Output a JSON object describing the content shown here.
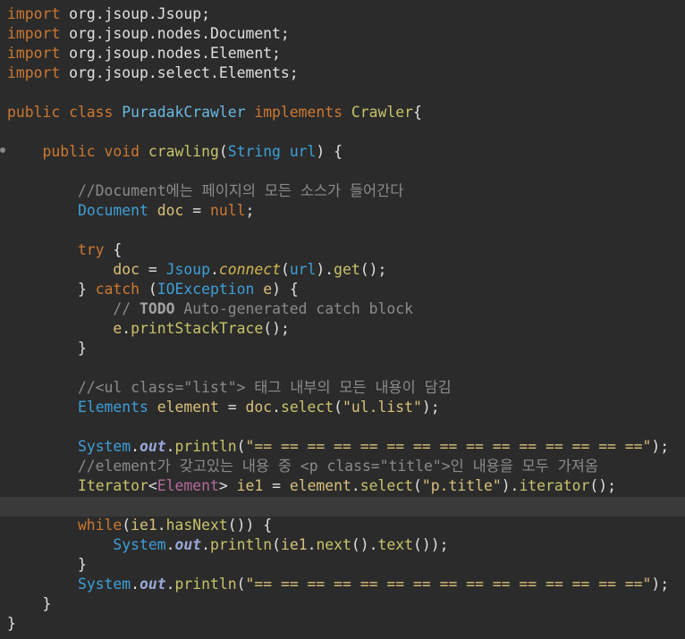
{
  "lines": [
    [
      {
        "t": "import",
        "c": "kw"
      },
      {
        "t": " org.jsoup.Jsoup;",
        "c": "pkg"
      }
    ],
    [
      {
        "t": "import",
        "c": "kw"
      },
      {
        "t": " org.jsoup.nodes.Document;",
        "c": "pkg"
      }
    ],
    [
      {
        "t": "import",
        "c": "kw"
      },
      {
        "t": " org.jsoup.nodes.Element;",
        "c": "pkg"
      }
    ],
    [
      {
        "t": "import",
        "c": "kw"
      },
      {
        "t": " org.jsoup.select.Elements;",
        "c": "pkg"
      }
    ],
    [],
    [
      {
        "t": "public class ",
        "c": "kw"
      },
      {
        "t": "PuradakCrawler",
        "c": "cls"
      },
      {
        "t": " implements ",
        "c": "kw"
      },
      {
        "t": "Crawler",
        "c": "meth"
      },
      {
        "t": "{",
        "c": "pl"
      }
    ],
    [],
    [
      {
        "t": "    public void ",
        "c": "kw"
      },
      {
        "t": "crawling",
        "c": "meth"
      },
      {
        "t": "(",
        "c": "pl"
      },
      {
        "t": "String",
        "c": "ty"
      },
      {
        "t": " ",
        "c": "pl"
      },
      {
        "t": "url",
        "c": "ty"
      },
      {
        "t": ") {",
        "c": "pl"
      }
    ],
    [],
    [
      {
        "t": "        //Document에는 페이지의 모든 소스가 들어간다",
        "c": "cm"
      }
    ],
    [
      {
        "t": "        ",
        "c": "pl"
      },
      {
        "t": "Document",
        "c": "ty"
      },
      {
        "t": " ",
        "c": "pl"
      },
      {
        "t": "doc",
        "c": "var"
      },
      {
        "t": " = ",
        "c": "pl"
      },
      {
        "t": "null",
        "c": "kw"
      },
      {
        "t": ";",
        "c": "pl"
      }
    ],
    [],
    [
      {
        "t": "        try",
        "c": "kw"
      },
      {
        "t": " {",
        "c": "pl"
      }
    ],
    [
      {
        "t": "            ",
        "c": "pl"
      },
      {
        "t": "doc",
        "c": "var"
      },
      {
        "t": " = ",
        "c": "pl"
      },
      {
        "t": "Jsoup",
        "c": "ty"
      },
      {
        "t": ".",
        "c": "pl"
      },
      {
        "t": "connect",
        "c": "sm"
      },
      {
        "t": "(",
        "c": "pl"
      },
      {
        "t": "url",
        "c": "ty"
      },
      {
        "t": ").",
        "c": "pl"
      },
      {
        "t": "get",
        "c": "meth"
      },
      {
        "t": "();",
        "c": "pl"
      }
    ],
    [
      {
        "t": "        } ",
        "c": "pl"
      },
      {
        "t": "catch",
        "c": "kw"
      },
      {
        "t": " (",
        "c": "pl"
      },
      {
        "t": "IOException",
        "c": "ty"
      },
      {
        "t": " ",
        "c": "pl"
      },
      {
        "t": "e",
        "c": "var"
      },
      {
        "t": ") {",
        "c": "pl"
      }
    ],
    [
      {
        "t": "            // ",
        "c": "cm"
      },
      {
        "t": "TODO",
        "c": "todo"
      },
      {
        "t": " Auto-generated catch block",
        "c": "cm"
      }
    ],
    [
      {
        "t": "            ",
        "c": "pl"
      },
      {
        "t": "e",
        "c": "var"
      },
      {
        "t": ".",
        "c": "pl"
      },
      {
        "t": "printStackTrace",
        "c": "meth"
      },
      {
        "t": "();",
        "c": "pl"
      }
    ],
    [
      {
        "t": "        }",
        "c": "pl"
      }
    ],
    [],
    [
      {
        "t": "        //<ul class=\"list\"> 태그 내부의 모든 내용이 담김",
        "c": "cm"
      }
    ],
    [
      {
        "t": "        ",
        "c": "pl"
      },
      {
        "t": "Elements",
        "c": "ty"
      },
      {
        "t": " ",
        "c": "pl"
      },
      {
        "t": "element",
        "c": "var"
      },
      {
        "t": " = ",
        "c": "pl"
      },
      {
        "t": "doc",
        "c": "var"
      },
      {
        "t": ".",
        "c": "pl"
      },
      {
        "t": "select",
        "c": "meth"
      },
      {
        "t": "(",
        "c": "pl"
      },
      {
        "t": "\"ul.list\"",
        "c": "str"
      },
      {
        "t": ");",
        "c": "pl"
      }
    ],
    [],
    [
      {
        "t": "        ",
        "c": "pl"
      },
      {
        "t": "System",
        "c": "ty"
      },
      {
        "t": ".",
        "c": "pl"
      },
      {
        "t": "out",
        "c": "fld"
      },
      {
        "t": ".",
        "c": "pl"
      },
      {
        "t": "println",
        "c": "meth"
      },
      {
        "t": "(",
        "c": "pl"
      },
      {
        "t": "\"== == == == == == == == == == == == == == ==\"",
        "c": "str"
      },
      {
        "t": ");",
        "c": "pl"
      }
    ],
    [
      {
        "t": "        //element가 갖고있는 내용 중 <p class=\"title\">인 내용을 모두 가져옴",
        "c": "cm"
      }
    ],
    [
      {
        "t": "        ",
        "c": "pl"
      },
      {
        "t": "Iterator",
        "c": "meth"
      },
      {
        "t": "<",
        "c": "pl"
      },
      {
        "t": "Element",
        "c": "gen"
      },
      {
        "t": "> ",
        "c": "pl"
      },
      {
        "t": "ie1",
        "c": "var"
      },
      {
        "t": " = ",
        "c": "pl"
      },
      {
        "t": "element",
        "c": "var"
      },
      {
        "t": ".",
        "c": "pl"
      },
      {
        "t": "select",
        "c": "meth"
      },
      {
        "t": "(",
        "c": "pl"
      },
      {
        "t": "\"p.title\"",
        "c": "str"
      },
      {
        "t": ").",
        "c": "pl"
      },
      {
        "t": "iterator",
        "c": "meth"
      },
      {
        "t": "();",
        "c": "pl"
      }
    ],
    [],
    [
      {
        "t": "        while",
        "c": "kw"
      },
      {
        "t": "(",
        "c": "pl"
      },
      {
        "t": "ie1",
        "c": "var"
      },
      {
        "t": ".",
        "c": "pl"
      },
      {
        "t": "hasNext",
        "c": "meth"
      },
      {
        "t": "()) {",
        "c": "pl"
      }
    ],
    [
      {
        "t": "            ",
        "c": "pl"
      },
      {
        "t": "System",
        "c": "ty"
      },
      {
        "t": ".",
        "c": "pl"
      },
      {
        "t": "out",
        "c": "fld"
      },
      {
        "t": ".",
        "c": "pl"
      },
      {
        "t": "println",
        "c": "meth"
      },
      {
        "t": "(",
        "c": "pl"
      },
      {
        "t": "ie1",
        "c": "var"
      },
      {
        "t": ".",
        "c": "pl"
      },
      {
        "t": "next",
        "c": "meth"
      },
      {
        "t": "().",
        "c": "pl"
      },
      {
        "t": "text",
        "c": "meth"
      },
      {
        "t": "());",
        "c": "pl"
      }
    ],
    [
      {
        "t": "        }",
        "c": "pl"
      }
    ],
    [
      {
        "t": "        ",
        "c": "pl"
      },
      {
        "t": "System",
        "c": "ty"
      },
      {
        "t": ".",
        "c": "pl"
      },
      {
        "t": "out",
        "c": "fld"
      },
      {
        "t": ".",
        "c": "pl"
      },
      {
        "t": "println",
        "c": "meth"
      },
      {
        "t": "(",
        "c": "pl"
      },
      {
        "t": "\"== == == == == == == == == == == == == == ==\"",
        "c": "str"
      },
      {
        "t": ");",
        "c": "pl"
      }
    ],
    [
      {
        "t": "    }",
        "c": "pl"
      }
    ],
    [
      {
        "t": "}",
        "c": "pl"
      }
    ]
  ]
}
